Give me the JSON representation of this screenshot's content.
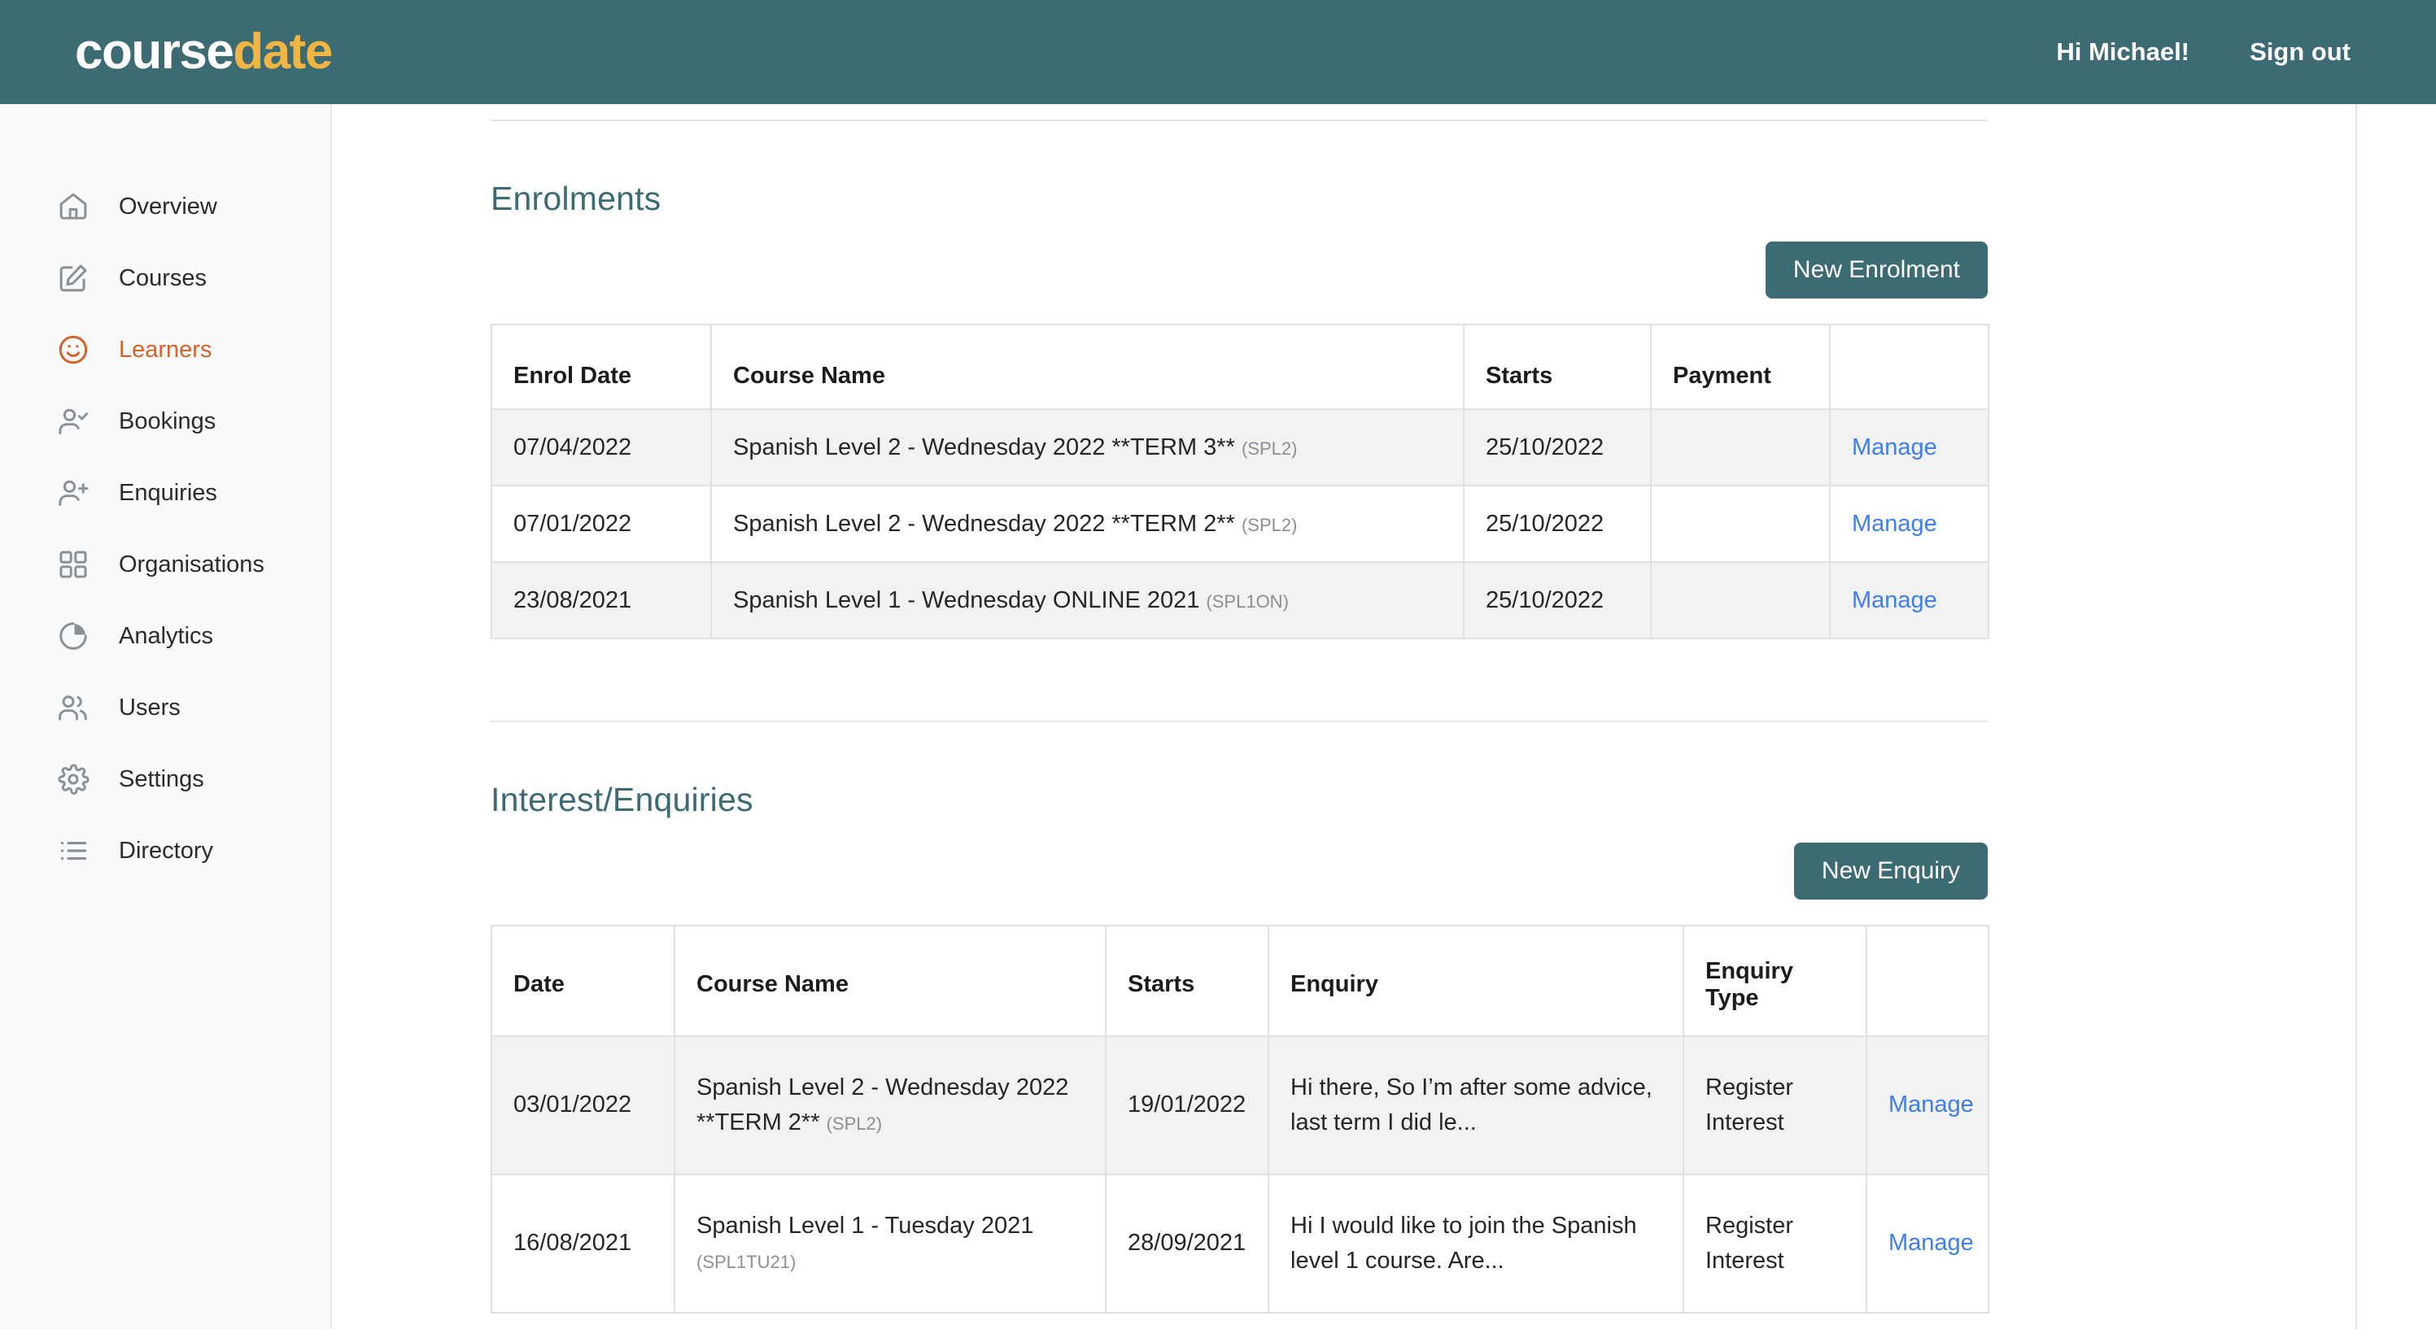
{
  "header": {
    "logo_part1": "course",
    "logo_part2": "date",
    "greeting": "Hi Michael!",
    "sign_out": "Sign out",
    "bg_color": "#3c6b73",
    "accent_color": "#f0b542"
  },
  "sidebar": {
    "active_color": "#d4632a",
    "items": [
      {
        "label": "Overview",
        "icon": "home-icon",
        "active": false
      },
      {
        "label": "Courses",
        "icon": "edit-square-icon",
        "active": false
      },
      {
        "label": "Learners",
        "icon": "smiley-face-icon",
        "active": true
      },
      {
        "label": "Bookings",
        "icon": "person-check-icon",
        "active": false
      },
      {
        "label": "Enquiries",
        "icon": "person-plus-icon",
        "active": false
      },
      {
        "label": "Organisations",
        "icon": "grid-icon",
        "active": false
      },
      {
        "label": "Analytics",
        "icon": "pie-chart-icon",
        "active": false
      },
      {
        "label": "Users",
        "icon": "users-icon",
        "active": false
      },
      {
        "label": "Settings",
        "icon": "gear-icon",
        "active": false
      },
      {
        "label": "Directory",
        "icon": "list-icon",
        "active": false
      }
    ]
  },
  "enrolments": {
    "title": "Enrolments",
    "new_button": "New Enrolment",
    "columns": [
      "Enrol Date",
      "Course Name",
      "Starts",
      "Payment",
      ""
    ],
    "rows": [
      {
        "enrol_date": "07/04/2022",
        "course_name": "Spanish Level 2 - Wednesday 2022 **TERM 3**",
        "course_code": "(SPL2)",
        "starts": "25/10/2022",
        "payment": "",
        "action": "Manage"
      },
      {
        "enrol_date": "07/01/2022",
        "course_name": "Spanish Level 2 - Wednesday 2022 **TERM 2**",
        "course_code": "(SPL2)",
        "starts": "25/10/2022",
        "payment": "",
        "action": "Manage"
      },
      {
        "enrol_date": "23/08/2021",
        "course_name": "Spanish Level 1 - Wednesday ONLINE 2021",
        "course_code": "(SPL1ON)",
        "starts": "25/10/2022",
        "payment": "",
        "action": "Manage"
      }
    ]
  },
  "enquiries": {
    "title": "Interest/Enquiries",
    "new_button": "New Enquiry",
    "columns": [
      "Date",
      "Course Name",
      "Starts",
      "Enquiry",
      "Enquiry Type",
      ""
    ],
    "enquiry_type_line1": "Enquiry",
    "enquiry_type_line2": "Type",
    "rows": [
      {
        "date": "03/01/2022",
        "course_name": "Spanish Level 2 - Wednesday 2022 **TERM 2**",
        "course_code": "(SPL2)",
        "starts": "19/01/2022",
        "enquiry": "Hi there, So I’m after some advice, last term I did le...",
        "enquiry_type": "Register Interest",
        "action": "Manage"
      },
      {
        "date": "16/08/2021",
        "course_name": "Spanish Level 1 - Tuesday 2021",
        "course_code": "(SPL1TU21)",
        "starts": "28/09/2021",
        "enquiry": "Hi I would like to join the Spanish level 1 course. Are...",
        "enquiry_type": "Register Interest",
        "action": "Manage"
      }
    ]
  }
}
